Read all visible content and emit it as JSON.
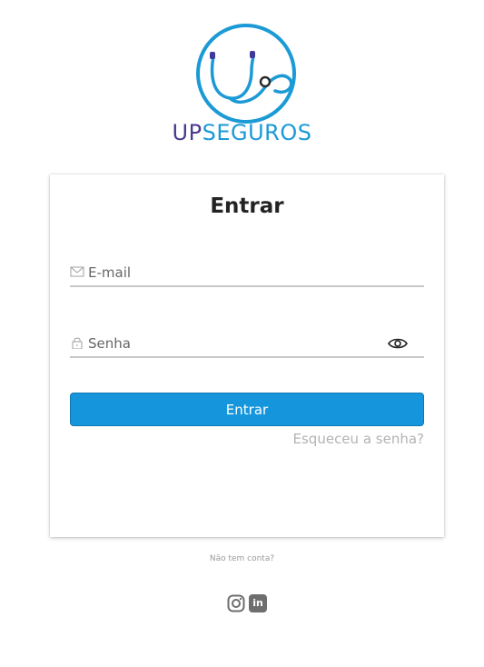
{
  "brand": {
    "name_part1": "UP",
    "name_part2": "SEGUROS",
    "colors": {
      "purple": "#4b3a8c",
      "blue": "#1b9ad6"
    },
    "logo_icon": "stethoscope-icon"
  },
  "login": {
    "title": "Entrar",
    "email_placeholder": "E-mail",
    "email_value": "",
    "password_placeholder": "Senha",
    "password_value": "",
    "submit_label": "Entrar",
    "forgot_label": "Esqueceu a senha?",
    "button_color": "#1596dc"
  },
  "footer": {
    "no_account_label": "Não tem conta?",
    "social": [
      {
        "icon": "instagram-icon"
      },
      {
        "icon": "linkedin-icon",
        "text": "in"
      }
    ]
  }
}
